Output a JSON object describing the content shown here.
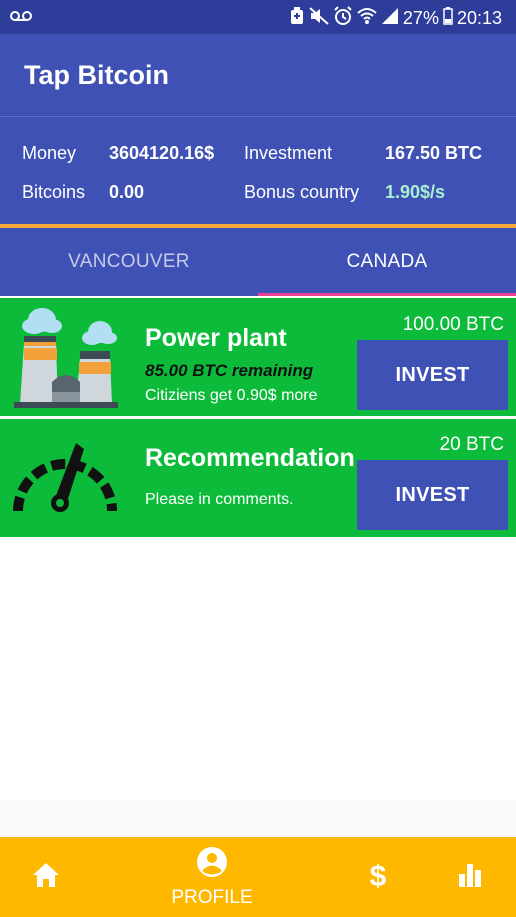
{
  "status_bar": {
    "battery": "27%",
    "time": "20:13"
  },
  "app": {
    "title": "Tap Bitcoin"
  },
  "stats": {
    "money_label": "Money",
    "money_value": "3604120.16$",
    "investment_label": "Investment",
    "investment_value": "167.50 BTC",
    "bitcoins_label": "Bitcoins",
    "bitcoins_value": "0.00",
    "bonus_label": "Bonus country",
    "bonus_value": "1.90$/s",
    "bonus_color": "#a8f0d0"
  },
  "tabs": [
    {
      "label": "VANCOUVER",
      "selected": false
    },
    {
      "label": "CANADA",
      "selected": true
    }
  ],
  "cards": [
    {
      "icon": "power-plant-icon",
      "title": "Power plant",
      "remaining": "85.00 BTC remaining",
      "subtitle": "Citiziens get 0.90$ more",
      "price": "100.00 BTC",
      "button": "INVEST"
    },
    {
      "icon": "speedometer-icon",
      "title": "Recommendation",
      "subtitle": "Please in comments.",
      "price": "20 BTC",
      "button": "INVEST"
    }
  ],
  "bottom_nav": {
    "home_icon": "home-icon",
    "profile_label": "PROFILE",
    "profile_icon": "account-circle-icon",
    "money_icon": "dollar-icon",
    "stats_icon": "bar-chart-icon"
  },
  "colors": {
    "primary": "#3f51b5",
    "status_bar": "#2e3c9a",
    "accent_orange": "#f4a93a",
    "card_green": "#0dbb3a",
    "tab_indicator": "#e84393",
    "bottom_nav": "#ffb800"
  }
}
